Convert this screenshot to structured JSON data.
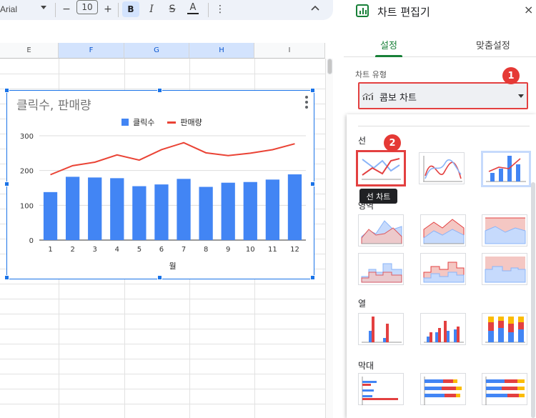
{
  "toolbar": {
    "font": "Arial",
    "minus": "−",
    "font_size": "10",
    "plus": "+",
    "bold": "B",
    "italic": "I",
    "strike": "S",
    "text_color": "A",
    "more": "⋮",
    "collapse": "^"
  },
  "columns": [
    {
      "label": "E",
      "selected": false
    },
    {
      "label": "F",
      "selected": true
    },
    {
      "label": "G",
      "selected": true
    },
    {
      "label": "H",
      "selected": true
    },
    {
      "label": "I",
      "selected": false
    }
  ],
  "chart_data": {
    "type": "combo",
    "title": "클릭수, 판매량",
    "xlabel": "월",
    "categories": [
      "1",
      "2",
      "3",
      "4",
      "5",
      "6",
      "7",
      "8",
      "9",
      "10",
      "11",
      "12"
    ],
    "ylim": [
      0,
      300
    ],
    "yticks": [
      0,
      100,
      200,
      300
    ],
    "series": [
      {
        "name": "클릭수",
        "kind": "bar",
        "color": "#4285f4",
        "values": [
          138,
          182,
          180,
          178,
          155,
          160,
          176,
          153,
          165,
          167,
          174,
          189
        ]
      },
      {
        "name": "판매량",
        "kind": "line",
        "color": "#ea4335",
        "values": [
          188,
          214,
          224,
          245,
          230,
          260,
          280,
          251,
          243,
          250,
          260,
          277
        ]
      }
    ],
    "legend_position": "top"
  },
  "panel": {
    "title": "차트 편집기",
    "close": "×",
    "tab_setup": "설정",
    "tab_customize": "맞춤설정",
    "chart_type_label": "차트 유형",
    "chart_type_value": "콤보 차트",
    "badge1": "1",
    "badge2": "2"
  },
  "dropdown": {
    "section_line": "선",
    "section_area": "영역",
    "section_column": "열",
    "section_bar": "막대",
    "tooltip": "선 차트"
  },
  "colors": {
    "accent": "#188038",
    "select_border": "#e34040",
    "blue": "#4285f4",
    "red": "#ea4335",
    "yellow": "#fbbc04"
  }
}
